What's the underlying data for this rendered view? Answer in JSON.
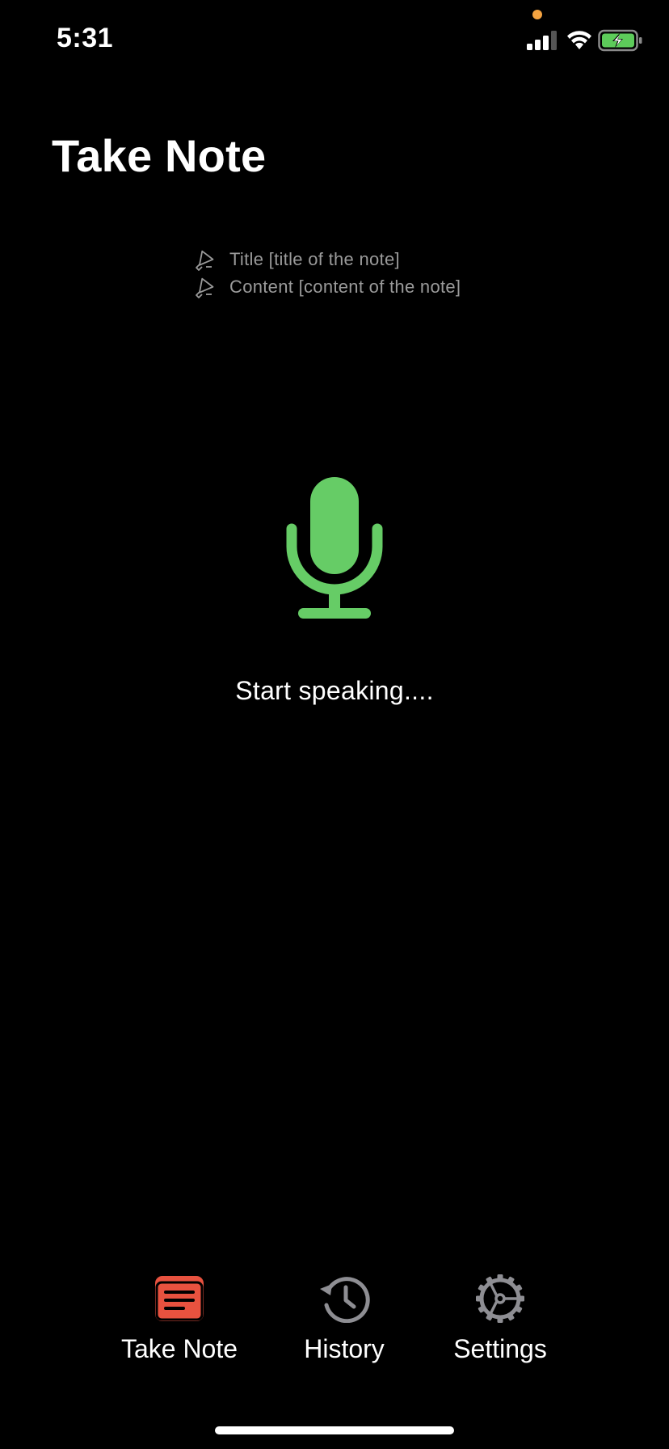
{
  "status_bar": {
    "time": "5:31",
    "icons": [
      "cellular-signal-icon",
      "wifi-icon",
      "battery-charging-icon"
    ],
    "privacy_indicator_color": "#F4A341",
    "battery_color": "#5DCB5A"
  },
  "header": {
    "title": "Take Note"
  },
  "hints": [
    {
      "icon": "megaphone-icon",
      "text": "Title [title of the note]"
    },
    {
      "icon": "megaphone-icon",
      "text": "Content [content of the note]"
    }
  ],
  "voice": {
    "icon": "microphone-icon",
    "icon_color": "#66CC66",
    "status_text": "Start speaking...."
  },
  "tab_bar": {
    "tabs": [
      {
        "label": "Take Note",
        "icon": "note-icon",
        "active": true,
        "color": "#E8523F"
      },
      {
        "label": "History",
        "icon": "history-clock-icon",
        "active": false,
        "color": "#8E8E93"
      },
      {
        "label": "Settings",
        "icon": "gear-icon",
        "active": false,
        "color": "#8E8E93"
      }
    ]
  }
}
